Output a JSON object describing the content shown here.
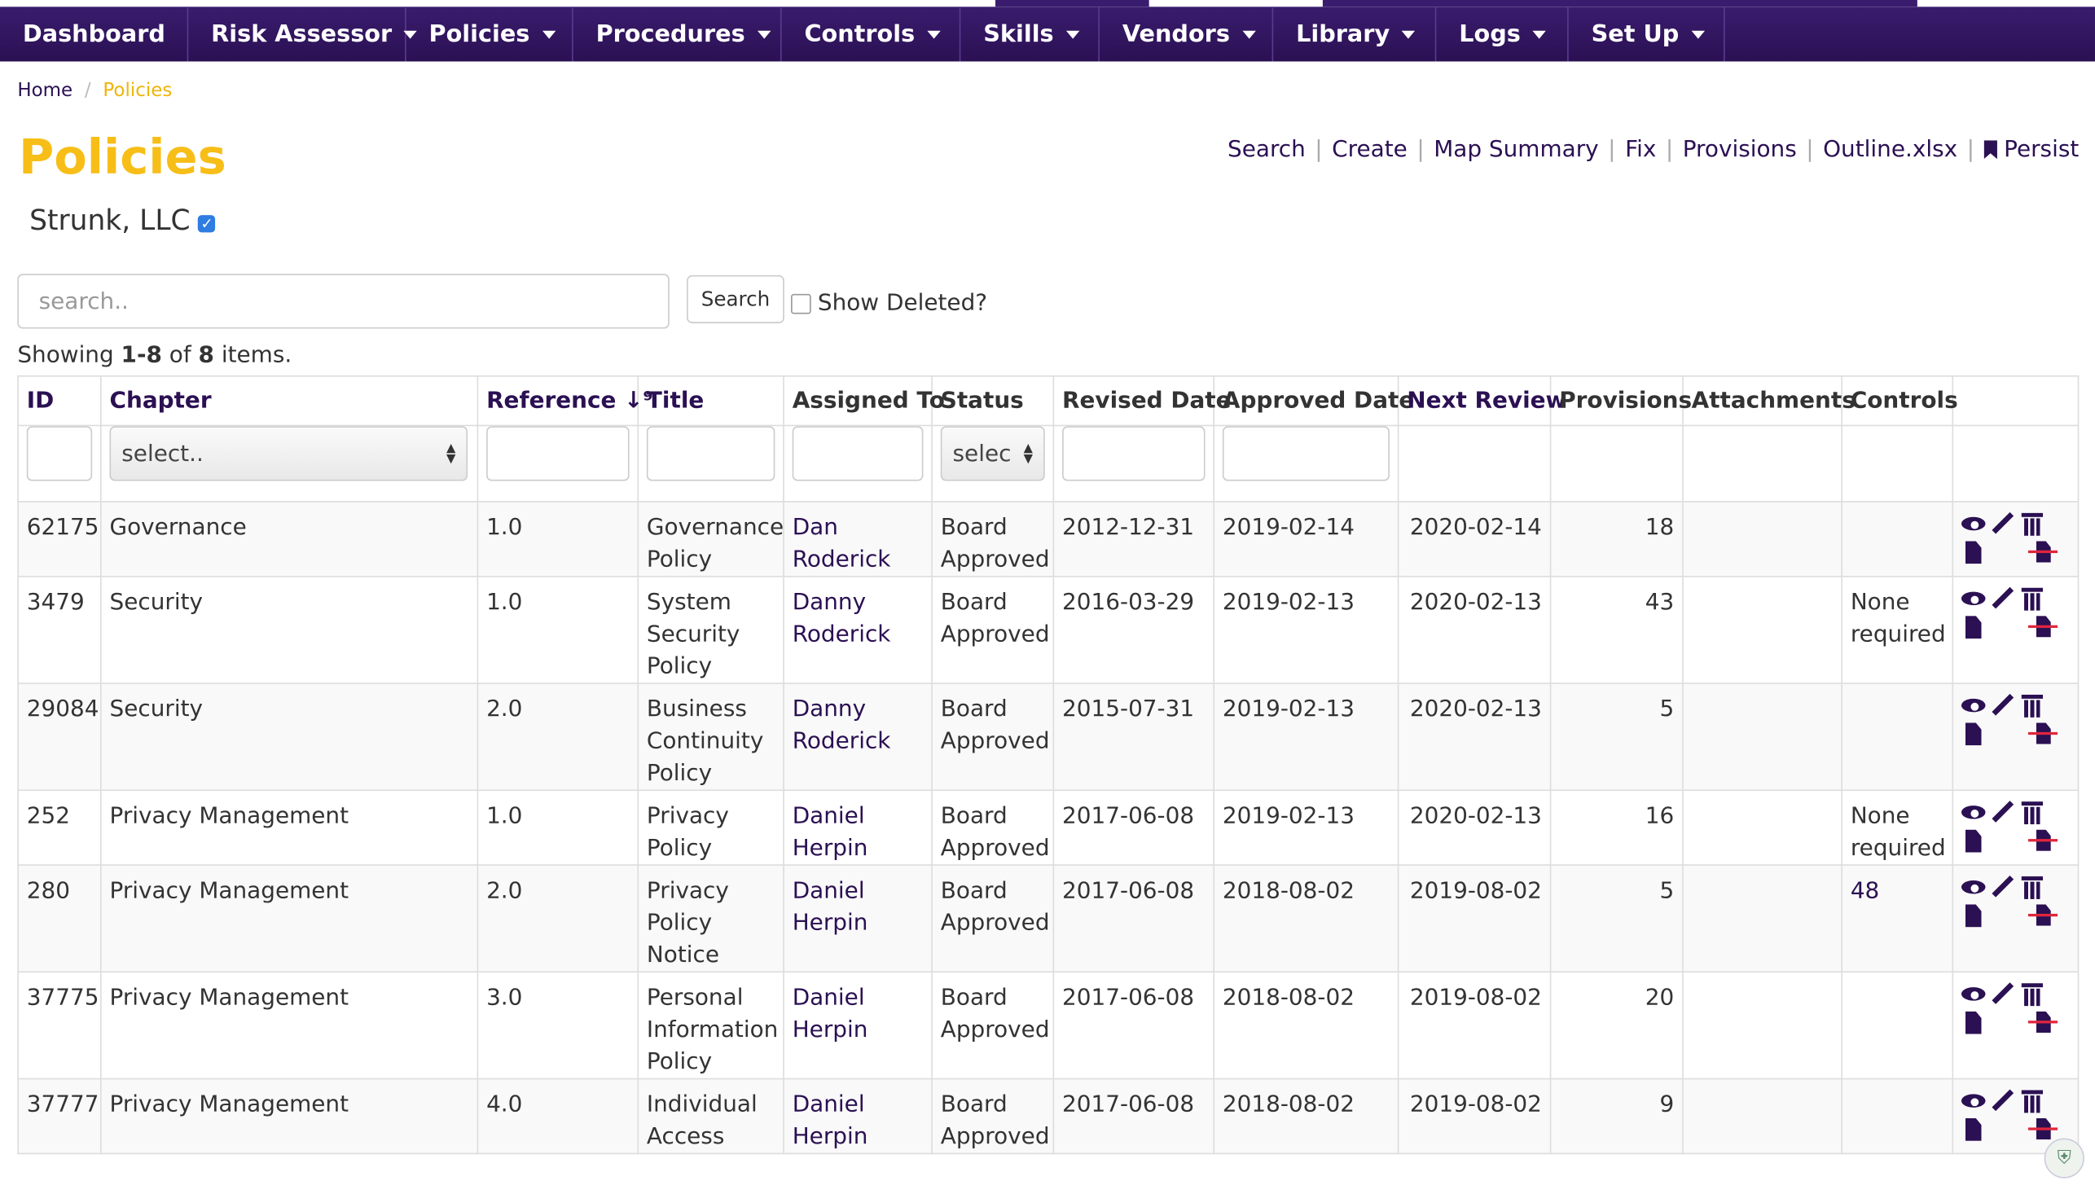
{
  "nav": [
    {
      "label": "Dashboard",
      "dropdown": false
    },
    {
      "label": "Risk Assessor",
      "dropdown": true
    },
    {
      "label": "Policies",
      "dropdown": true
    },
    {
      "label": "Procedures",
      "dropdown": true
    },
    {
      "label": "Controls",
      "dropdown": true
    },
    {
      "label": "Skills",
      "dropdown": true
    },
    {
      "label": "Vendors",
      "dropdown": true
    },
    {
      "label": "Library",
      "dropdown": true
    },
    {
      "label": "Logs",
      "dropdown": true
    },
    {
      "label": "Set Up",
      "dropdown": true
    }
  ],
  "breadcrumb": {
    "home": "Home",
    "sep": "/",
    "current": "Policies"
  },
  "page": {
    "title": "Policies",
    "org": "Strunk, LLC"
  },
  "actions": [
    "Search",
    "Create",
    "Map Summary",
    "Fix",
    "Provisions",
    "Outline.xlsx",
    "Persist"
  ],
  "search": {
    "placeholder": "search..",
    "button": "Search",
    "show_deleted": "Show Deleted?"
  },
  "summary": {
    "prefix": "Showing ",
    "range": "1-8",
    "of": " of ",
    "total": "8",
    "suffix": " items."
  },
  "table": {
    "columns": [
      "ID",
      "Chapter",
      "Reference",
      "Title",
      "Assigned To",
      "Status",
      "Revised Date",
      "Approved Date",
      "Next Review",
      "Provisions",
      "Attachments",
      "Controls"
    ],
    "filters": {
      "chapter_select": "select..",
      "status_select": "selec"
    },
    "rows": [
      {
        "id": "62175",
        "chapter": "Governance",
        "reference": "1.0",
        "title": "Governance Policy",
        "assigned": "Dan Roderick",
        "status": "Board Approved",
        "revised": "2012-12-31",
        "approved": "2019-02-14",
        "next": "2020-02-14",
        "provisions": "18",
        "attachments": "",
        "controls": ""
      },
      {
        "id": "3479",
        "chapter": "Security",
        "reference": "1.0",
        "title": "System Security Policy",
        "assigned": "Danny Roderick",
        "status": "Board Approved",
        "revised": "2016-03-29",
        "approved": "2019-02-13",
        "next": "2020-02-13",
        "provisions": "43",
        "attachments": "",
        "controls": "None required"
      },
      {
        "id": "29084",
        "chapter": "Security",
        "reference": "2.0",
        "title": "Business Continuity Policy",
        "assigned": "Danny Roderick",
        "status": "Board Approved",
        "revised": "2015-07-31",
        "approved": "2019-02-13",
        "next": "2020-02-13",
        "provisions": "5",
        "attachments": "",
        "controls": ""
      },
      {
        "id": "252",
        "chapter": "Privacy Management",
        "reference": "1.0",
        "title": "Privacy Policy",
        "assigned": "Daniel Herpin",
        "status": "Board Approved",
        "revised": "2017-06-08",
        "approved": "2019-02-13",
        "next": "2020-02-13",
        "provisions": "16",
        "attachments": "",
        "controls": "None required"
      },
      {
        "id": "280",
        "chapter": "Privacy Management",
        "reference": "2.0",
        "title": "Privacy Policy Notice",
        "assigned": "Daniel Herpin",
        "status": "Board Approved",
        "revised": "2017-06-08",
        "approved": "2018-08-02",
        "next": "2019-08-02",
        "provisions": "5",
        "attachments": "",
        "controls": "48"
      },
      {
        "id": "37775",
        "chapter": "Privacy Management",
        "reference": "3.0",
        "title": "Personal Information Policy",
        "assigned": "Daniel Herpin",
        "status": "Board Approved",
        "revised": "2017-06-08",
        "approved": "2018-08-02",
        "next": "2019-08-02",
        "provisions": "20",
        "attachments": "",
        "controls": ""
      },
      {
        "id": "37777",
        "chapter": "Privacy Management",
        "reference": "4.0",
        "title": "Individual Access",
        "assigned": "Daniel Herpin",
        "status": "Board Approved",
        "revised": "2017-06-08",
        "approved": "2018-08-02",
        "next": "2019-08-02",
        "provisions": "9",
        "attachments": "",
        "controls": ""
      }
    ]
  },
  "colors": {
    "brand": "#2b1053",
    "accent": "#f7be18",
    "danger": "#e0263d"
  }
}
